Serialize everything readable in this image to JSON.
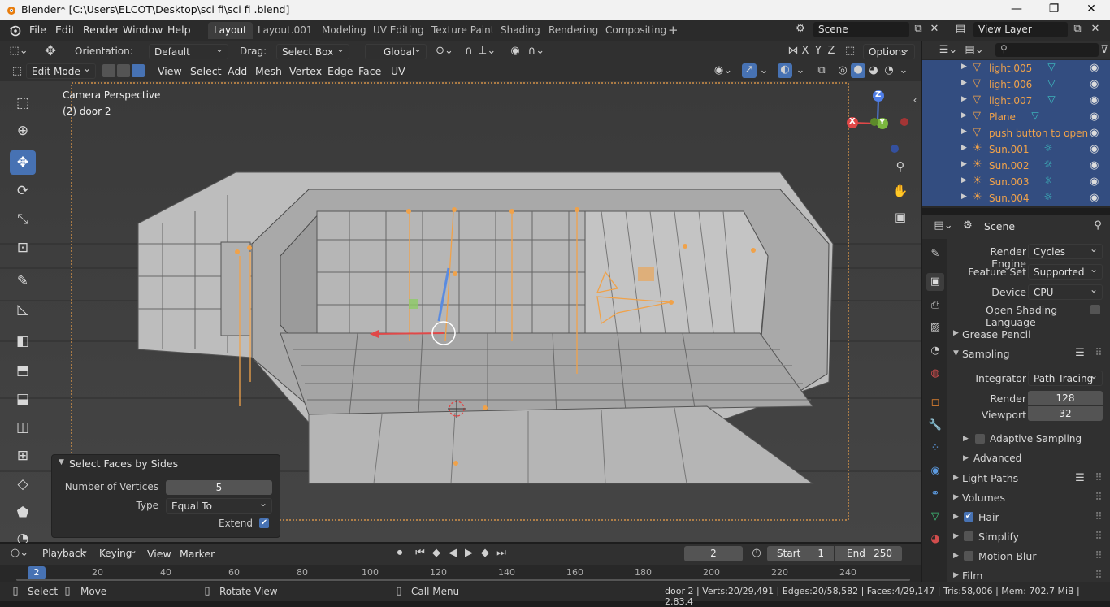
{
  "window": {
    "title": "Blender* [C:\\Users\\ELCOT\\Desktop\\sci fi\\sci fi .blend]",
    "minimize": "—",
    "maximize": "❐",
    "close": "✕"
  },
  "menu": {
    "items": [
      "File",
      "Edit",
      "Render",
      "Window",
      "Help"
    ]
  },
  "workspaces": {
    "tabs": [
      "Layout",
      "Layout.001",
      "Modeling",
      "UV Editing",
      "Texture Paint",
      "Shading",
      "Rendering",
      "Compositing"
    ],
    "active": "Layout",
    "add": "+"
  },
  "scene": {
    "name": "Scene",
    "view_layer": "View Layer"
  },
  "tool_header": {
    "orientation_label": "Orientation:",
    "orientation_value": "Default",
    "drag_label": "Drag:",
    "drag_value": "Select Box",
    "transform_orientation": "Global",
    "axes": [
      "X",
      "Y",
      "Z"
    ],
    "options": "Options"
  },
  "view_header": {
    "mode": "Edit Mode",
    "menus": [
      "View",
      "Select",
      "Add",
      "Mesh",
      "Vertex",
      "Edge",
      "Face",
      "UV"
    ]
  },
  "viewport": {
    "camera_label": "Camera Perspective",
    "object_label": "(2) door 2",
    "gizmo": {
      "x": "X",
      "y": "Y",
      "z": "Z"
    }
  },
  "operator_panel": {
    "title": "Select Faces by Sides",
    "fields": [
      {
        "label": "Number of Vertices",
        "value": "5"
      },
      {
        "label": "Type",
        "value": "Equal To"
      },
      {
        "label": "Extend",
        "checked": true
      }
    ]
  },
  "outliner": {
    "items": [
      {
        "name": "light.005",
        "kind": "mesh"
      },
      {
        "name": "light.006",
        "kind": "mesh"
      },
      {
        "name": "light.007",
        "kind": "mesh"
      },
      {
        "name": "Plane",
        "kind": "mesh"
      },
      {
        "name": "push button to open",
        "kind": "mesh"
      },
      {
        "name": "Sun.001",
        "kind": "light"
      },
      {
        "name": "Sun.002",
        "kind": "light"
      },
      {
        "name": "Sun.003",
        "kind": "light"
      },
      {
        "name": "Sun.004",
        "kind": "light"
      }
    ]
  },
  "properties": {
    "header": "Scene",
    "render_engine": {
      "label": "Render Engine",
      "value": "Cycles"
    },
    "feature_set": {
      "label": "Feature Set",
      "value": "Supported"
    },
    "device": {
      "label": "Device",
      "value": "CPU"
    },
    "osl": {
      "label": "Open Shading Language",
      "checked": false
    },
    "sections": {
      "grease_pencil": "Grease Pencil",
      "sampling": "Sampling",
      "integrator": {
        "label": "Integrator",
        "value": "Path Tracing"
      },
      "render": {
        "label": "Render",
        "value": "128"
      },
      "viewport": {
        "label": "Viewport",
        "value": "32"
      },
      "adaptive_sampling": "Adaptive Sampling",
      "advanced": "Advanced",
      "light_paths": "Light Paths",
      "volumes": "Volumes",
      "hair": {
        "label": "Hair",
        "checked": true
      },
      "simplify": {
        "label": "Simplify",
        "checked": false
      },
      "motion_blur": {
        "label": "Motion Blur",
        "checked": false
      },
      "film": "Film"
    }
  },
  "timeline": {
    "menus": [
      "Playback",
      "Keying",
      "View",
      "Marker"
    ],
    "current_frame": "2",
    "start_label": "Start",
    "start": "1",
    "end_label": "End",
    "end": "250",
    "ruler": [
      "2",
      "20",
      "40",
      "60",
      "80",
      "100",
      "120",
      "140",
      "160",
      "180",
      "200",
      "220",
      "240"
    ]
  },
  "statusbar": {
    "hints": [
      "Select",
      "Move",
      "Rotate View",
      "Call Menu"
    ],
    "stats": "door 2 | Verts:20/29,491 | Edges:20/58,582 | Faces:4/29,147 | Tris:58,006 | Mem: 702.7 MiB | 2.83.4"
  },
  "colors": {
    "accent": "#4772b3",
    "selection_orange": "#f0a24a",
    "outliner_selected": "#334d80"
  }
}
